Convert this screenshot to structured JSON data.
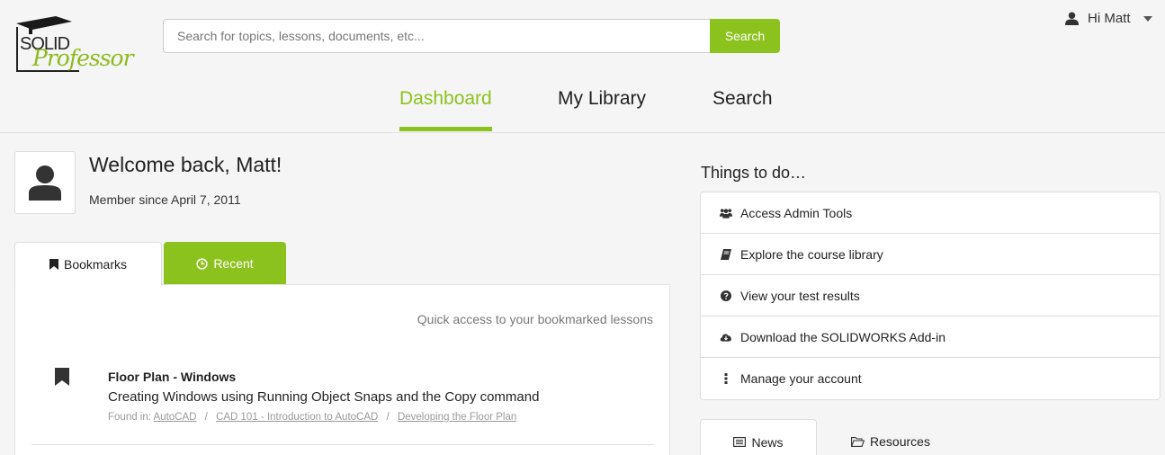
{
  "header": {
    "logo": {
      "line1": "SOLID",
      "line2": "Professor"
    },
    "search": {
      "placeholder": "Search for topics, lessons, documents, etc...",
      "button_label": "Search"
    },
    "user": {
      "greeting": "Hi Matt"
    }
  },
  "nav": {
    "items": [
      {
        "label": "Dashboard",
        "active": true
      },
      {
        "label": "My Library",
        "active": false
      },
      {
        "label": "Search",
        "active": false
      }
    ]
  },
  "profile": {
    "welcome": "Welcome back, Matt!",
    "member_since": "Member since April 7, 2011"
  },
  "tabs": {
    "bookmarks": "Bookmarks",
    "recent": "Recent"
  },
  "bookmarks_panel": {
    "intro": "Quick access to your bookmarked lessons",
    "items": [
      {
        "title": "Floor Plan - Windows",
        "description": "Creating Windows using Running Object Snaps and the Copy command",
        "found_in_label": "Found in:",
        "path": [
          "AutoCAD",
          "CAD 101 - Introduction to AutoCAD",
          "Developing the Floor Plan"
        ],
        "separator": "/"
      }
    ]
  },
  "todo": {
    "title": "Things to do…",
    "items": [
      {
        "label": "Access Admin Tools",
        "icon": "users-icon"
      },
      {
        "label": "Explore the course library",
        "icon": "book-icon"
      },
      {
        "label": "View your test results",
        "icon": "question-circle-icon"
      },
      {
        "label": "Download the SOLIDWORKS Add-in",
        "icon": "cloud-download-icon"
      },
      {
        "label": "Manage your account",
        "icon": "vertical-ellipsis-icon"
      }
    ]
  },
  "right_tabs": {
    "news": "News",
    "resources": "Resources"
  },
  "colors": {
    "accent": "#8cc21e",
    "background": "#f5f5f5"
  }
}
